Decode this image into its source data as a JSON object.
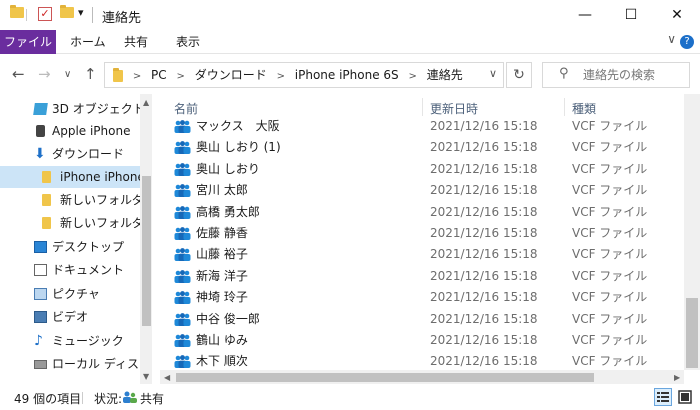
{
  "window": {
    "title": "連絡先",
    "minimize": "—",
    "maximize": "☐",
    "close": "✕",
    "qa_dropdown": "▾"
  },
  "ribbon": {
    "tabs": [
      "ファイル",
      "ホーム",
      "共有",
      "表示"
    ],
    "expand_icon": "∨",
    "help_icon": "?"
  },
  "nav": {
    "back": "←",
    "forward": "→",
    "recent": "∨",
    "up": "↑"
  },
  "address": {
    "crumbs": [
      "PC",
      "ダウンロード",
      "iPhone iPhone 6S",
      "連絡先"
    ],
    "separator": ">",
    "dropdown": "∨",
    "refresh": "↻"
  },
  "search": {
    "placeholder": "連絡先の検索",
    "icon": "⚲"
  },
  "sidebar": {
    "items": [
      {
        "label": "3D オブジェクト",
        "icon": "cube-icon"
      },
      {
        "label": "Apple iPhone",
        "icon": "phone-icon"
      },
      {
        "label": "ダウンロード",
        "icon": "download-icon"
      },
      {
        "label": "iPhone iPhone",
        "icon": "folder-icon",
        "selected": true
      },
      {
        "label": "新しいフォルダー",
        "icon": "folder-icon"
      },
      {
        "label": "新しいフォルダー (",
        "icon": "folder-icon"
      },
      {
        "label": "デスクトップ",
        "icon": "desktop-icon"
      },
      {
        "label": "ドキュメント",
        "icon": "document-icon"
      },
      {
        "label": "ピクチャ",
        "icon": "picture-icon"
      },
      {
        "label": "ビデオ",
        "icon": "video-icon"
      },
      {
        "label": "ミュージック",
        "icon": "music-icon"
      },
      {
        "label": "ローカル ディスク (C",
        "icon": "disk-icon"
      }
    ]
  },
  "columns": {
    "name": "名前",
    "modified": "更新日時",
    "type": "種類"
  },
  "files": [
    {
      "name": "マックス　大阪",
      "modified": "2021/12/16 15:18",
      "type": "VCF ファイル"
    },
    {
      "name": "奥山 しおり (1)",
      "modified": "2021/12/16 15:18",
      "type": "VCF ファイル"
    },
    {
      "name": "奥山 しおり",
      "modified": "2021/12/16 15:18",
      "type": "VCF ファイル"
    },
    {
      "name": "宮川 太郎",
      "modified": "2021/12/16 15:18",
      "type": "VCF ファイル"
    },
    {
      "name": "高橋 勇太郎",
      "modified": "2021/12/16 15:18",
      "type": "VCF ファイル"
    },
    {
      "name": "佐藤 静香",
      "modified": "2021/12/16 15:18",
      "type": "VCF ファイル"
    },
    {
      "name": "山藤 裕子",
      "modified": "2021/12/16 15:18",
      "type": "VCF ファイル"
    },
    {
      "name": "新海 洋子",
      "modified": "2021/12/16 15:18",
      "type": "VCF ファイル"
    },
    {
      "name": "神埼 玲子",
      "modified": "2021/12/16 15:18",
      "type": "VCF ファイル"
    },
    {
      "name": "中谷 俊一郎",
      "modified": "2021/12/16 15:18",
      "type": "VCF ファイル"
    },
    {
      "name": "鶴山 ゆみ",
      "modified": "2021/12/16 15:18",
      "type": "VCF ファイル"
    },
    {
      "name": "木下 順次",
      "modified": "2021/12/16 15:18",
      "type": "VCF ファイル"
    }
  ],
  "status": {
    "count": "49 個の項目",
    "state_label": "状況:",
    "share": "共有"
  },
  "colors": {
    "file_tab": "#6a2d9e",
    "selection": "#cce4f7",
    "header_text": "#4c607a"
  }
}
